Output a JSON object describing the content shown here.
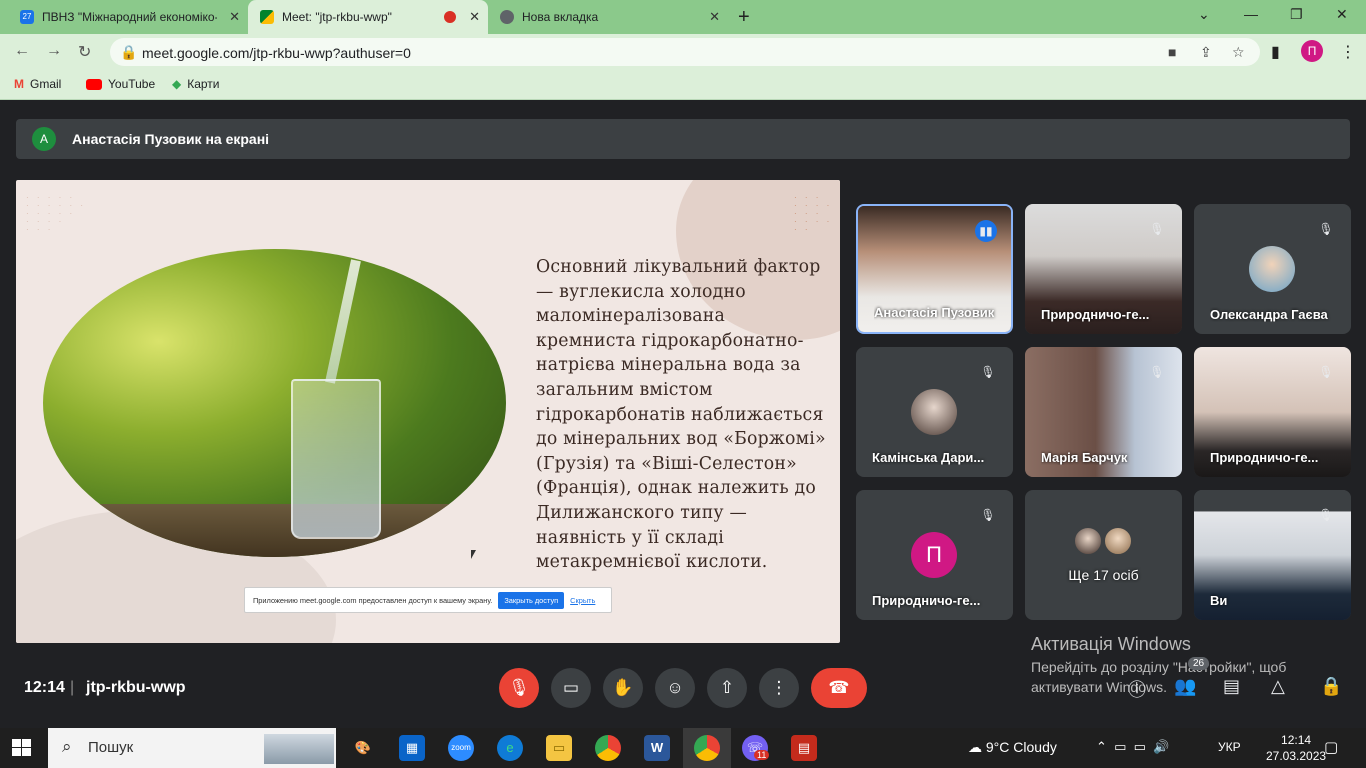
{
  "browser": {
    "tabs": [
      {
        "title": "ПВНЗ \"Міжнародний економіко-",
        "favicon_text": "27",
        "color": "#1a73e8"
      },
      {
        "title": "Meet: \"jtp-rkbu-wwp\"",
        "color": "#00897b"
      },
      {
        "title": "Нова вкладка",
        "color": "#5f6368"
      }
    ],
    "new_tab": "+",
    "address": "meet.google.com/jtp-rkbu-wwp?authuser=0",
    "profile_initial": "П",
    "bookmarks": [
      {
        "label": "Gmail",
        "color": "#ea4335"
      },
      {
        "label": "YouTube",
        "color": "#ff0000"
      },
      {
        "label": "Карти",
        "color": "#34a853"
      }
    ]
  },
  "meet": {
    "presenter_initial": "A",
    "presenter_banner": "Анастасія Пузовик на екрані",
    "slide_text": "Основний лікувальний фактор — вуглекисла холодно маломінералізована кремниста гідрокарбонатно-натрієва мінеральна вода  за загальним вмістом гідрокарбонатів наближається до мінеральних вод «Боржомі» (Грузія) та «Віші-Селестон» (Франція), однак належить до Дилижанского типу — наявність у її складі метакремнієвої кислоти.",
    "share_notice": "Приложению meet.google.com предоставлен доступ к вашему экрану.",
    "share_stop": "Закрыть доступ",
    "share_hide": "Скрыть",
    "participants": [
      {
        "name": "Анастасія Пузовик",
        "speaking": true
      },
      {
        "name": "Природничо-ге..."
      },
      {
        "name": "Олександра Гаєва"
      },
      {
        "name": "Камінська Дари..."
      },
      {
        "name": "Марія Барчук"
      },
      {
        "name": "Природничо-ге..."
      },
      {
        "name": "Природничо-ге...",
        "initial": "П"
      },
      {
        "name": "Ще 17 осіб"
      },
      {
        "name": "Ви"
      }
    ],
    "time": "12:14",
    "separator": "|",
    "meeting_code": "jtp-rkbu-wwp",
    "participant_count": "26",
    "activation_title": "Активація Windows",
    "activation_text": "Перейдіть до розділу \"Настройки\", щоб активувати Windows."
  },
  "taskbar": {
    "search_placeholder": "Пошук",
    "weather": "9°C  Cloudy",
    "language": "УКР",
    "time": "12:14",
    "date": "27.03.2023",
    "viber_badge": "11"
  },
  "colors": {
    "meet_bg": "#202124",
    "tile_bg": "#3c4043",
    "red": "#ea4335",
    "chrome_green": "#8bc98b"
  }
}
